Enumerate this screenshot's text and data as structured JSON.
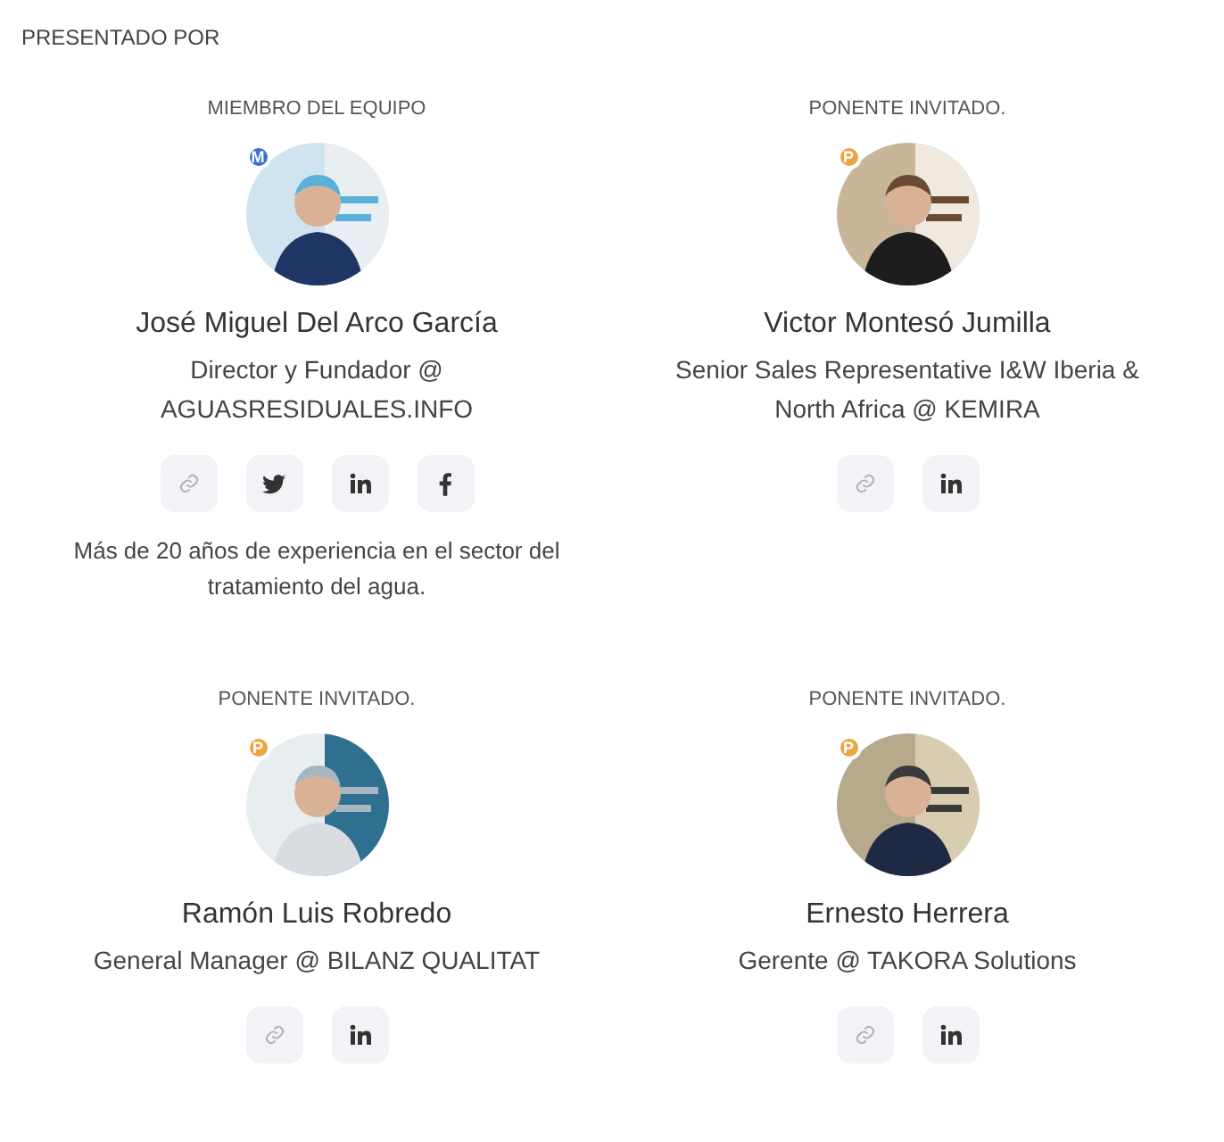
{
  "section_title": "PRESENTADO POR",
  "speakers": [
    {
      "role": "MIEMBRO DEL EQUIPO",
      "badge": {
        "letter": "M",
        "color": "#3a6fd6"
      },
      "name": "José Miguel Del Arco García",
      "position": "Director y Fundador @ AGUASRESIDUALES.INFO",
      "links": [
        {
          "kind": "link"
        },
        {
          "kind": "twitter"
        },
        {
          "kind": "linkedin"
        },
        {
          "kind": "facebook"
        }
      ],
      "bio": "Más de 20 años de experiencia en el sector del tratamiento del agua."
    },
    {
      "role": "PONENTE INVITADO.",
      "badge": {
        "letter": "P",
        "color": "#f0a343"
      },
      "name": "Victor Montesó Jumilla",
      "position": "Senior Sales Representative I&W Iberia & North Africa @ KEMIRA",
      "links": [
        {
          "kind": "link"
        },
        {
          "kind": "linkedin"
        }
      ]
    },
    {
      "role": "PONENTE INVITADO.",
      "badge": {
        "letter": "P",
        "color": "#f0a343"
      },
      "name": "Ramón Luis Robredo",
      "position": "General Manager @ BILANZ QUALITAT",
      "links": [
        {
          "kind": "link"
        },
        {
          "kind": "linkedin"
        }
      ]
    },
    {
      "role": "PONENTE INVITADO.",
      "badge": {
        "letter": "P",
        "color": "#f0a343"
      },
      "name": "Ernesto Herrera",
      "position": "Gerente @ TAKORA Solutions",
      "links": [
        {
          "kind": "link"
        },
        {
          "kind": "linkedin"
        }
      ]
    }
  ]
}
